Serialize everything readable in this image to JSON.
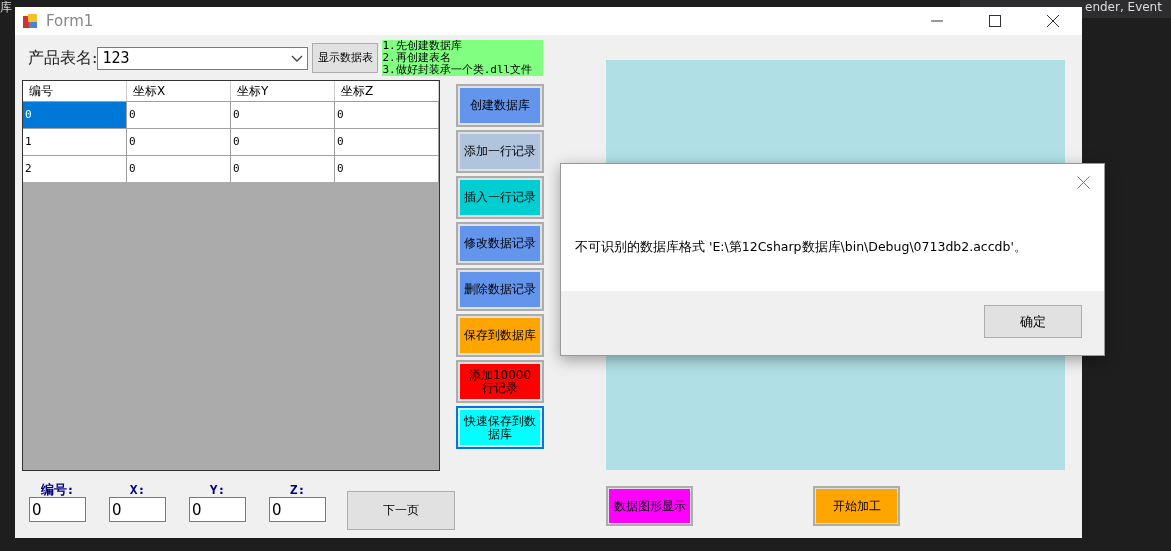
{
  "ide_background": {
    "texts": [
      "库",
      "ender, Event"
    ]
  },
  "window": {
    "title": "Form1"
  },
  "table_name": {
    "label": "产品表名:",
    "value": "123"
  },
  "show_table_button": "显示数据表",
  "note": [
    "1.先创建数据库",
    "2.再创建表名",
    "3.做好封装承一个类.dll文件"
  ],
  "grid": {
    "columns": [
      "编号",
      "坐标X",
      "坐标Y",
      "坐标Z"
    ],
    "rows": [
      {
        "cells": [
          {
            "text": "0",
            "selected": true
          },
          {
            "text": "0",
            "selected": false
          },
          {
            "text": "0",
            "selected": false
          },
          {
            "text": "0",
            "selected": false
          }
        ]
      },
      {
        "cells": [
          {
            "text": "1",
            "selected": false
          },
          {
            "text": "0",
            "selected": false
          },
          {
            "text": "0",
            "selected": false
          },
          {
            "text": "0",
            "selected": false
          }
        ]
      },
      {
        "cells": [
          {
            "text": "2",
            "selected": false
          },
          {
            "text": "0",
            "selected": false
          },
          {
            "text": "0",
            "selected": false
          },
          {
            "text": "0",
            "selected": false
          }
        ]
      }
    ]
  },
  "actions": [
    {
      "label": "创建数据库",
      "color": "#6495ed",
      "focused": false
    },
    {
      "label": "添加一行记录",
      "color": "#b0c4de",
      "focused": false
    },
    {
      "label": "插入一行记录",
      "color": "#00ced1",
      "focused": false
    },
    {
      "label": "修改数据记录",
      "color": "#6495ed",
      "focused": false
    },
    {
      "label": "删除数据记录",
      "color": "#6495ed",
      "focused": false
    },
    {
      "label": "保存到数据库",
      "color": "#ffa500",
      "focused": false
    },
    {
      "label": "添加10000行记录",
      "color": "#ff0000",
      "focused": false
    },
    {
      "label": "快速保存到数据库",
      "color": "#00ffff",
      "focused": true
    }
  ],
  "fields": [
    {
      "label": "编号:",
      "value": "0"
    },
    {
      "label": "X:",
      "value": "0"
    },
    {
      "label": "Y:",
      "value": "0"
    },
    {
      "label": "Z:",
      "value": "0"
    }
  ],
  "next_page_button": "下一页",
  "bottom_buttons": [
    {
      "label": "数据图形显示",
      "color": "#ff00ff"
    },
    {
      "label": "开始加工",
      "color": "#ffa500"
    }
  ],
  "dialog": {
    "message": "不可识别的数据库格式 'E:\\第12Csharp数据库\\bin\\Debug\\0713db2.accdb'。",
    "ok_button": "确定"
  }
}
